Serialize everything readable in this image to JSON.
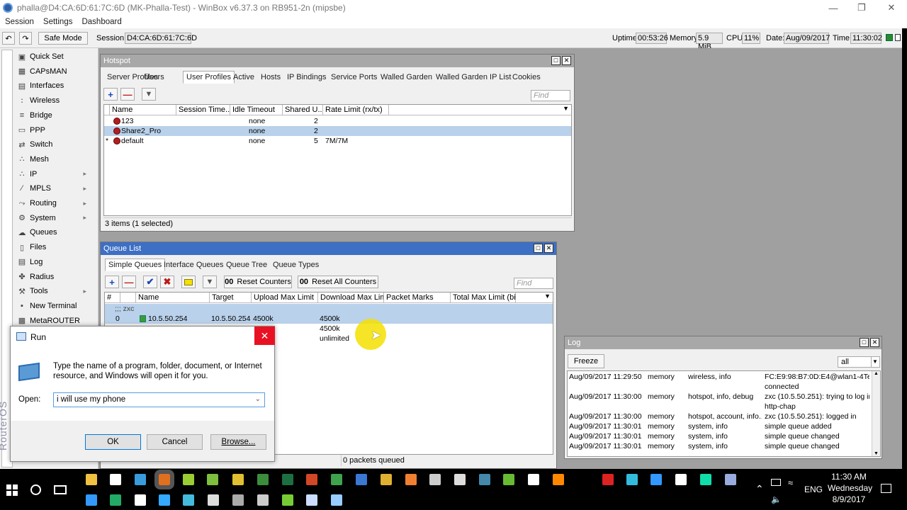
{
  "window": {
    "title": "phalla@D4:CA:6D:61:7C:6D (MK-Phalla-Test) - WinBox v6.37.3 on RB951-2n (mipsbe)"
  },
  "menu": [
    "Session",
    "Settings",
    "Dashboard"
  ],
  "toolbar": {
    "safe_mode": "Safe Mode",
    "session_label": "Session:",
    "session_value": "D4:CA:6D:61:7C:6D",
    "uptime_label": "Uptime:",
    "uptime_value": "00:53:26",
    "memory_label": "Memory:",
    "memory_value": "5.9 MiB",
    "cpu_label": "CPU:",
    "cpu_value": "11%",
    "date_label": "Date:",
    "date_value": "Aug/09/2017",
    "time_label": "Time:",
    "time_value": "11:30:02"
  },
  "sidebar": {
    "brand": "RouterOS WinBox",
    "items": [
      {
        "label": "Quick Set",
        "icon": "quickset-icon",
        "sub": false
      },
      {
        "label": "CAPsMAN",
        "icon": "capsman-icon",
        "sub": false
      },
      {
        "label": "Interfaces",
        "icon": "interfaces-icon",
        "sub": false
      },
      {
        "label": "Wireless",
        "icon": "wireless-icon",
        "sub": false
      },
      {
        "label": "Bridge",
        "icon": "bridge-icon",
        "sub": false
      },
      {
        "label": "PPP",
        "icon": "ppp-icon",
        "sub": false
      },
      {
        "label": "Switch",
        "icon": "switch-icon",
        "sub": false
      },
      {
        "label": "Mesh",
        "icon": "mesh-icon",
        "sub": false
      },
      {
        "label": "IP",
        "icon": "ip-icon",
        "sub": true
      },
      {
        "label": "MPLS",
        "icon": "mpls-icon",
        "sub": true
      },
      {
        "label": "Routing",
        "icon": "routing-icon",
        "sub": true
      },
      {
        "label": "System",
        "icon": "system-icon",
        "sub": true
      },
      {
        "label": "Queues",
        "icon": "queues-icon",
        "sub": false
      },
      {
        "label": "Files",
        "icon": "files-icon",
        "sub": false
      },
      {
        "label": "Log",
        "icon": "log-icon",
        "sub": false
      },
      {
        "label": "Radius",
        "icon": "radius-icon",
        "sub": false
      },
      {
        "label": "Tools",
        "icon": "tools-icon",
        "sub": true
      },
      {
        "label": "New Terminal",
        "icon": "terminal-icon",
        "sub": false
      },
      {
        "label": "MetaROUTER",
        "icon": "metarouter-icon",
        "sub": false
      }
    ]
  },
  "hotspot": {
    "title": "Hotspot",
    "tabs": [
      "Server Profiles",
      "Users",
      "User Profiles",
      "Active",
      "Hosts",
      "IP Bindings",
      "Service Ports",
      "Walled Garden",
      "Walled Garden IP List",
      "Cookies"
    ],
    "active_tab": "User Profiles",
    "find_placeholder": "Find",
    "columns": [
      "Name",
      "Session Time...",
      "Idle Timeout",
      "Shared U...",
      "Rate Limit (rx/tx)"
    ],
    "rows": [
      {
        "marker": "",
        "name": "123",
        "session": "",
        "idle": "none",
        "shared": "2",
        "rate": ""
      },
      {
        "marker": "",
        "name": "Share2_Pro",
        "session": "",
        "idle": "none",
        "shared": "2",
        "rate": ""
      },
      {
        "marker": "*",
        "name": "default",
        "session": "",
        "idle": "none",
        "shared": "5",
        "rate": "7M/7M"
      }
    ],
    "status": "3 items (1 selected)"
  },
  "queue": {
    "title": "Queue List",
    "tabs": [
      "Simple Queues",
      "Interface Queues",
      "Queue Tree",
      "Queue Types"
    ],
    "reset_counters": "Reset Counters",
    "reset_all": "Reset All Counters",
    "find_placeholder": "Find",
    "columns": [
      "#",
      "Name",
      "Target",
      "Upload Max Limit",
      "Download Max Limit",
      "Packet Marks",
      "Total Max Limit (bi..."
    ],
    "comment": ";;; zxc",
    "rows": [
      {
        "num": "0",
        "name": "10.5.50.254",
        "target": "10.5.50.254",
        "up": "4500k",
        "down": "4500k"
      },
      {
        "num": "",
        "name": "",
        "target": "",
        "up": "",
        "down": "4500k"
      },
      {
        "num": "",
        "name": "",
        "target": "d",
        "up": "",
        "down": "unlimited"
      }
    ],
    "status": "0 packets queued"
  },
  "log": {
    "title": "Log",
    "freeze": "Freeze",
    "filter": "all",
    "entries": [
      {
        "time": "Aug/09/2017 11:29:50",
        "buffer": "memory",
        "topics": "wireless, info",
        "message": "FC:E9:98:B7:0D:E4@wlan1-4Tes",
        "message2": "connected"
      },
      {
        "time": "Aug/09/2017 11:30:00",
        "buffer": "memory",
        "topics": "hotspot, info, debug",
        "message": "zxc (10.5.50.251): trying to log in b",
        "message2": "http-chap"
      },
      {
        "time": "Aug/09/2017 11:30:00",
        "buffer": "memory",
        "topics": "hotspot, account, info...",
        "message": "zxc (10.5.50.251): logged in",
        "message2": ""
      },
      {
        "time": "Aug/09/2017 11:30:01",
        "buffer": "memory",
        "topics": "system, info",
        "message": "simple queue added",
        "message2": ""
      },
      {
        "time": "Aug/09/2017 11:30:01",
        "buffer": "memory",
        "topics": "system, info",
        "message": "simple queue changed",
        "message2": ""
      },
      {
        "time": "Aug/09/2017 11:30:01",
        "buffer": "memory",
        "topics": "system, info",
        "message": "simple queue changed",
        "message2": ""
      }
    ]
  },
  "run": {
    "title": "Run",
    "description": "Type the name of a program, folder, document, or Internet resource, and Windows will open it for you.",
    "open_label": "Open:",
    "open_value": "i will use my phone",
    "ok": "OK",
    "cancel": "Cancel",
    "browse": "Browse..."
  },
  "taskbar": {
    "time": "11:30 AM",
    "day": "Wednesday",
    "date": "8/9/2017",
    "lang": "ENG"
  },
  "colors": {
    "accent_blue": "#3d6fc4",
    "selected_row": "#b9d1ea",
    "run_close": "#e81123"
  }
}
